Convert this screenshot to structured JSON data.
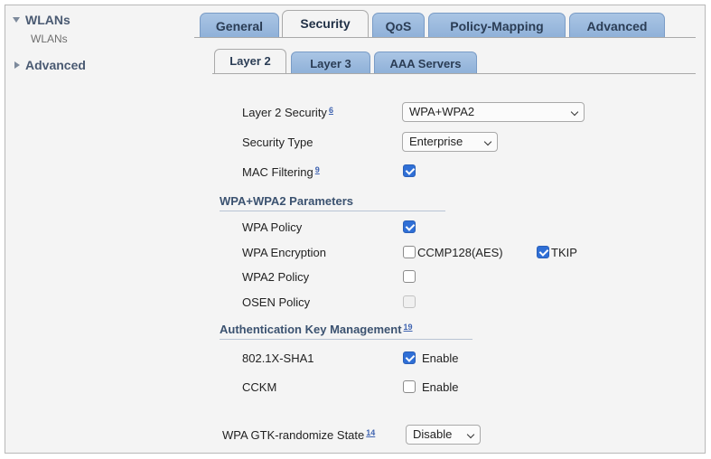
{
  "nav": {
    "wlans_label": "WLANs",
    "wlans_sub_label": "WLANs",
    "advanced_label": "Advanced"
  },
  "tabs": [
    {
      "label": "General",
      "active": false
    },
    {
      "label": "Security",
      "active": true
    },
    {
      "label": "QoS",
      "active": false
    },
    {
      "label": "Policy-Mapping",
      "active": false
    },
    {
      "label": "Advanced",
      "active": false
    }
  ],
  "subtabs": [
    {
      "label": "Layer 2",
      "active": true
    },
    {
      "label": "Layer 3",
      "active": false
    },
    {
      "label": "AAA Servers",
      "active": false
    }
  ],
  "layer2": {
    "layer2_security_label": "Layer 2 Security",
    "layer2_security_help": "6",
    "layer2_security_value": "WPA+WPA2",
    "security_type_label": "Security Type",
    "security_type_value": "Enterprise",
    "mac_filtering_label": "MAC Filtering",
    "mac_filtering_help": "9",
    "mac_filtering_checked": true
  },
  "wpa_params": {
    "title": "WPA+WPA2 Parameters",
    "wpa_policy_label": "WPA Policy",
    "wpa_policy_checked": true,
    "wpa_encryption_label": "WPA Encryption",
    "ccmp_label": "CCMP128(AES)",
    "ccmp_checked": false,
    "tkip_label": "TKIP",
    "tkip_checked": true,
    "wpa2_policy_label": "WPA2 Policy",
    "wpa2_policy_checked": false,
    "osen_policy_label": "OSEN Policy",
    "osen_policy_checked": false
  },
  "akm": {
    "title": "Authentication Key Management",
    "help": "19",
    "dot1x_label": "802.1X-SHA1",
    "dot1x_enable_label": "Enable",
    "dot1x_checked": true,
    "cckm_label": "CCKM",
    "cckm_enable_label": "Enable",
    "cckm_checked": false
  },
  "gtk": {
    "label": "WPA GTK-randomize State",
    "help": "14",
    "value": "Disable"
  },
  "colors": {
    "tab_blue": "#8eb0d8",
    "checkbox_blue": "#2f6fd6",
    "section_text": "#3b5270"
  }
}
